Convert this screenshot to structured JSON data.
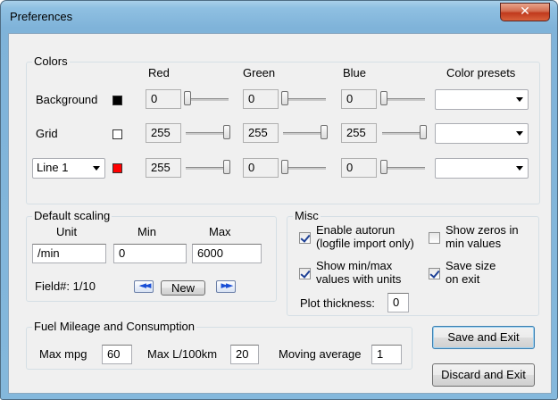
{
  "window": {
    "title": "Preferences",
    "close_glyph": "✕"
  },
  "colors": {
    "legend": "Colors",
    "headers": {
      "red": "Red",
      "green": "Green",
      "blue": "Blue",
      "presets": "Color presets"
    },
    "background": {
      "label": "Background",
      "swatch": "#000000",
      "red": "0",
      "green": "0",
      "blue": "0",
      "red_level": 0,
      "green_level": 0,
      "blue_level": 0,
      "preset": ""
    },
    "grid": {
      "label": "Grid",
      "swatch": "#ffffff",
      "red": "255",
      "green": "255",
      "blue": "255",
      "red_level": 1,
      "green_level": 1,
      "blue_level": 1,
      "preset": ""
    },
    "line": {
      "selector": "Line 1",
      "swatch": "#ff0000",
      "red": "255",
      "green": "0",
      "blue": "0",
      "red_level": 1,
      "green_level": 0,
      "blue_level": 0,
      "preset": ""
    }
  },
  "scaling": {
    "legend": "Default scaling",
    "unit_label": "Unit",
    "min_label": "Min",
    "max_label": "Max",
    "unit_value": "/min",
    "min_value": "0",
    "max_value": "6000",
    "field_text": "Field#: 1/10",
    "prev_icon": "◄◄",
    "new_label": "New",
    "next_icon": "►►"
  },
  "misc": {
    "legend": "Misc",
    "autorun": {
      "line1": "Enable autorun",
      "line2": "(logfile import only)",
      "checked": true
    },
    "showminmax": {
      "line1": "Show min/max",
      "line2": "values with units",
      "checked": true
    },
    "showzeros": {
      "line1": "Show zeros in",
      "line2": "min values",
      "checked": false
    },
    "savesize": {
      "line1": "Save size",
      "line2": "on exit",
      "checked": true
    },
    "plot_thickness_label": "Plot thickness:",
    "plot_thickness_value": "0"
  },
  "fuel": {
    "legend": "Fuel Mileage and Consumption",
    "max_mpg_label": "Max mpg",
    "max_mpg_value": "60",
    "max_l_label": "Max L/100km",
    "max_l_value": "20",
    "moving_avg_label": "Moving average",
    "moving_avg_value": "1"
  },
  "buttons": {
    "save_exit": "Save and Exit",
    "discard_exit": "Discard and Exit"
  }
}
